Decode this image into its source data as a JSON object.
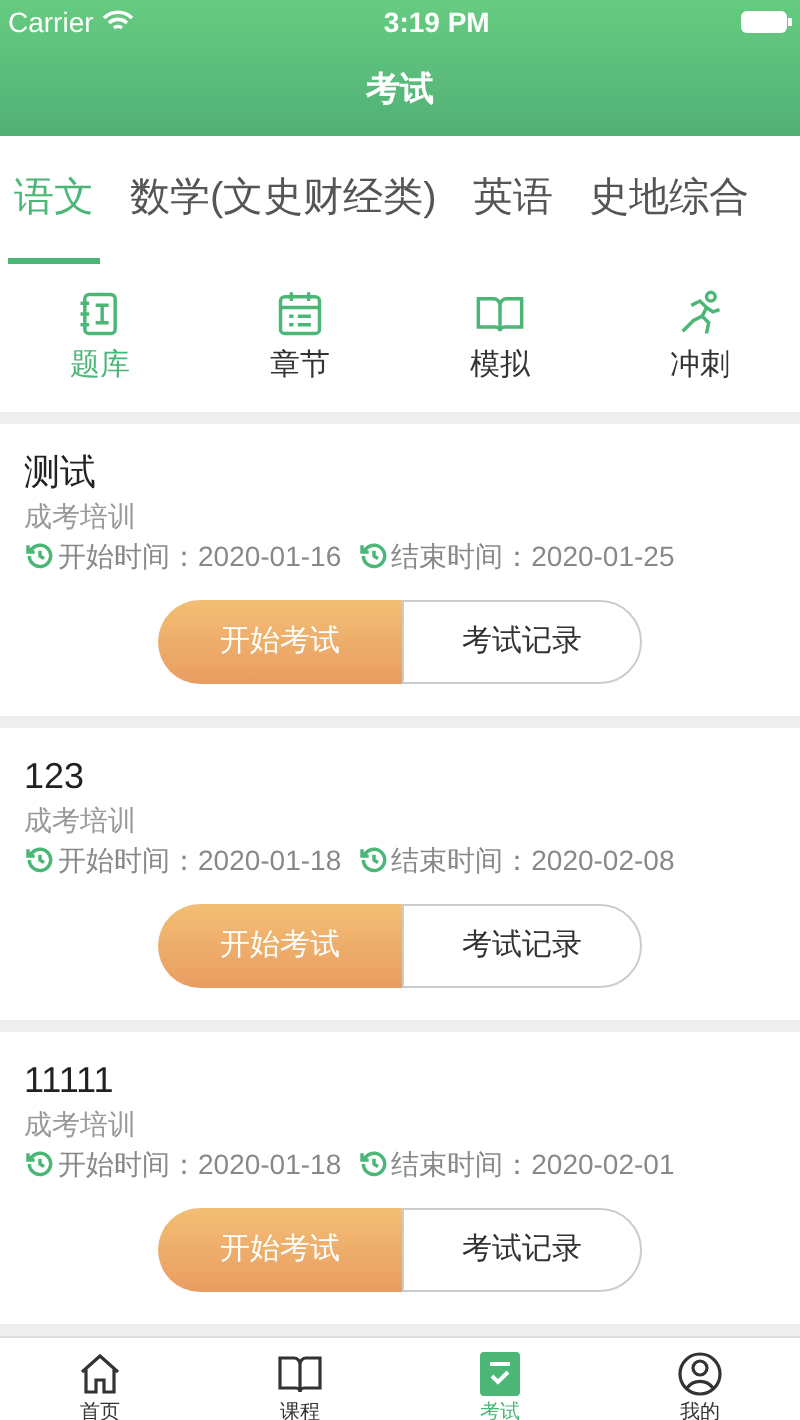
{
  "status_bar": {
    "carrier": "Carrier",
    "time": "3:19 PM"
  },
  "nav": {
    "title": "考试"
  },
  "subjects": [
    {
      "label": "语文",
      "selected": true
    },
    {
      "label": "数学(文史财经类)",
      "selected": false
    },
    {
      "label": "英语",
      "selected": false
    },
    {
      "label": "史地综合",
      "selected": false
    }
  ],
  "categories": [
    {
      "kind": "bank",
      "label": "题库",
      "selected": true
    },
    {
      "kind": "chapter",
      "label": "章节",
      "selected": false
    },
    {
      "kind": "mock",
      "label": "模拟",
      "selected": false
    },
    {
      "kind": "sprint",
      "label": "冲刺",
      "selected": false
    }
  ],
  "exams": [
    {
      "title": "测试",
      "org": "成考培训",
      "start_label": "开始时间：",
      "start": "2020-01-16",
      "end_label": "结束时间：",
      "end": "2020-01-25",
      "start_button": "开始考试",
      "record_button": "考试记录"
    },
    {
      "title": "123",
      "org": "成考培训",
      "start_label": "开始时间：",
      "start": "2020-01-18",
      "end_label": "结束时间：",
      "end": "2020-02-08",
      "start_button": "开始考试",
      "record_button": "考试记录"
    },
    {
      "title": "11111",
      "org": "成考培训",
      "start_label": "开始时间：",
      "start": "2020-01-18",
      "end_label": "结束时间：",
      "end": "2020-02-01",
      "start_button": "开始考试",
      "record_button": "考试记录"
    }
  ],
  "tab_bar": [
    {
      "kind": "home",
      "label": "首页",
      "selected": false
    },
    {
      "kind": "course",
      "label": "课程",
      "selected": false
    },
    {
      "kind": "exam",
      "label": "考试",
      "selected": true
    },
    {
      "kind": "me",
      "label": "我的",
      "selected": false
    }
  ]
}
